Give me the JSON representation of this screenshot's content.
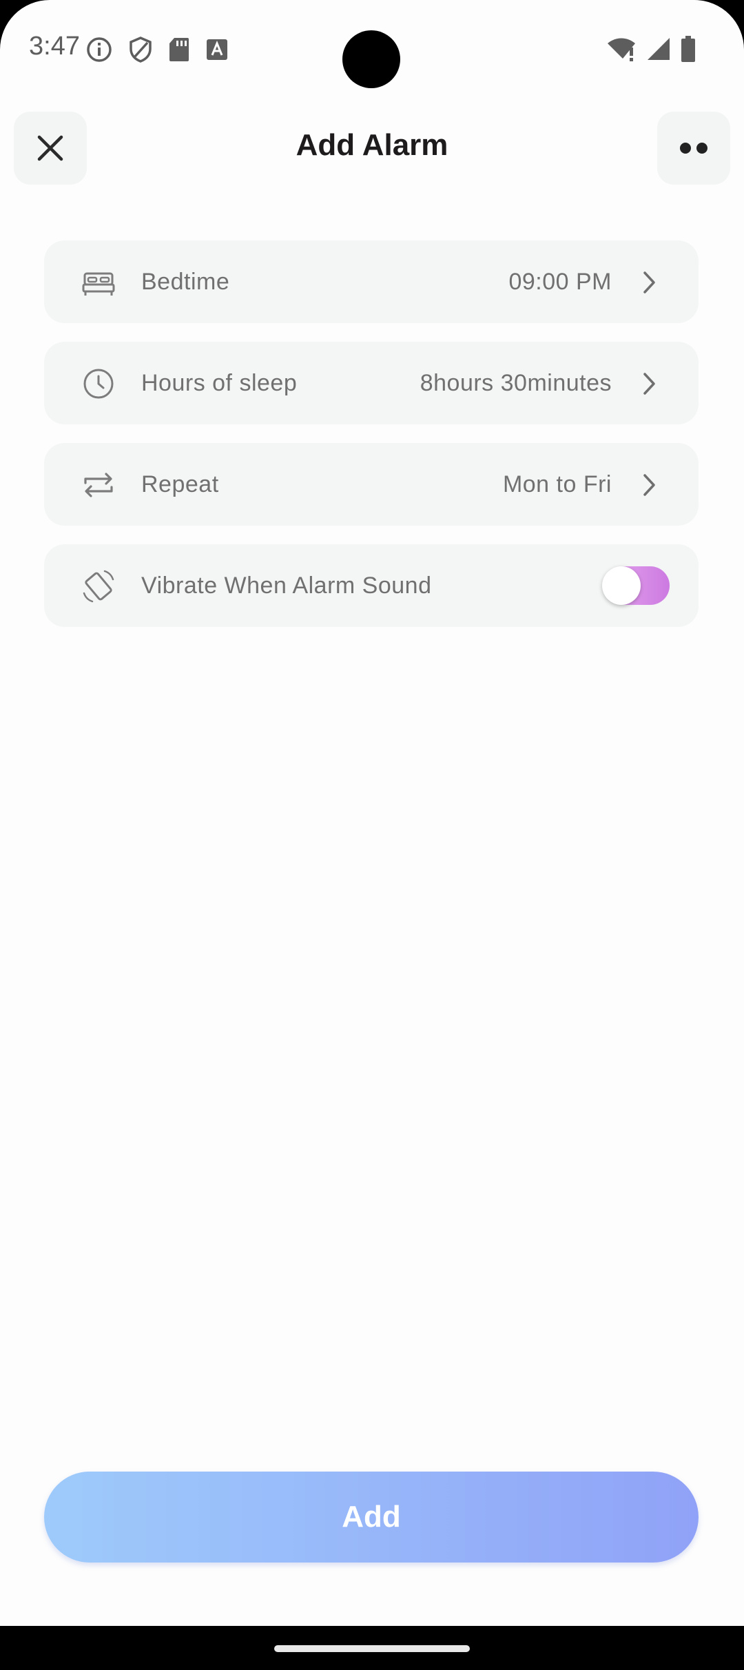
{
  "status_bar": {
    "time": "3:47",
    "left_icons": [
      "info-icon",
      "shield-icon",
      "sd-card-icon",
      "text-a-icon"
    ],
    "right_icons": [
      "wifi-alert-icon",
      "signal-icon",
      "battery-icon"
    ]
  },
  "header": {
    "title": "Add Alarm",
    "close_icon": "close-icon",
    "more_icon": "more-icon"
  },
  "settings": [
    {
      "icon": "bed-icon",
      "label": "Bedtime",
      "value": "09:00 PM"
    },
    {
      "icon": "clock-icon",
      "label": "Hours of sleep",
      "value": "8hours 30minutes"
    },
    {
      "icon": "repeat-icon",
      "label": "Repeat",
      "value": "Mon to Fri"
    },
    {
      "icon": "vibrate-icon",
      "label": "Vibrate When Alarm Sound",
      "toggle_on": false
    }
  ],
  "add_button": {
    "label": "Add"
  },
  "colors": {
    "accent_gradient_start": "#9ecbfb",
    "accent_gradient_end": "#90a2f7",
    "toggle_gradient": "#cc7ae0",
    "row_bg": "#f4f5f5"
  }
}
